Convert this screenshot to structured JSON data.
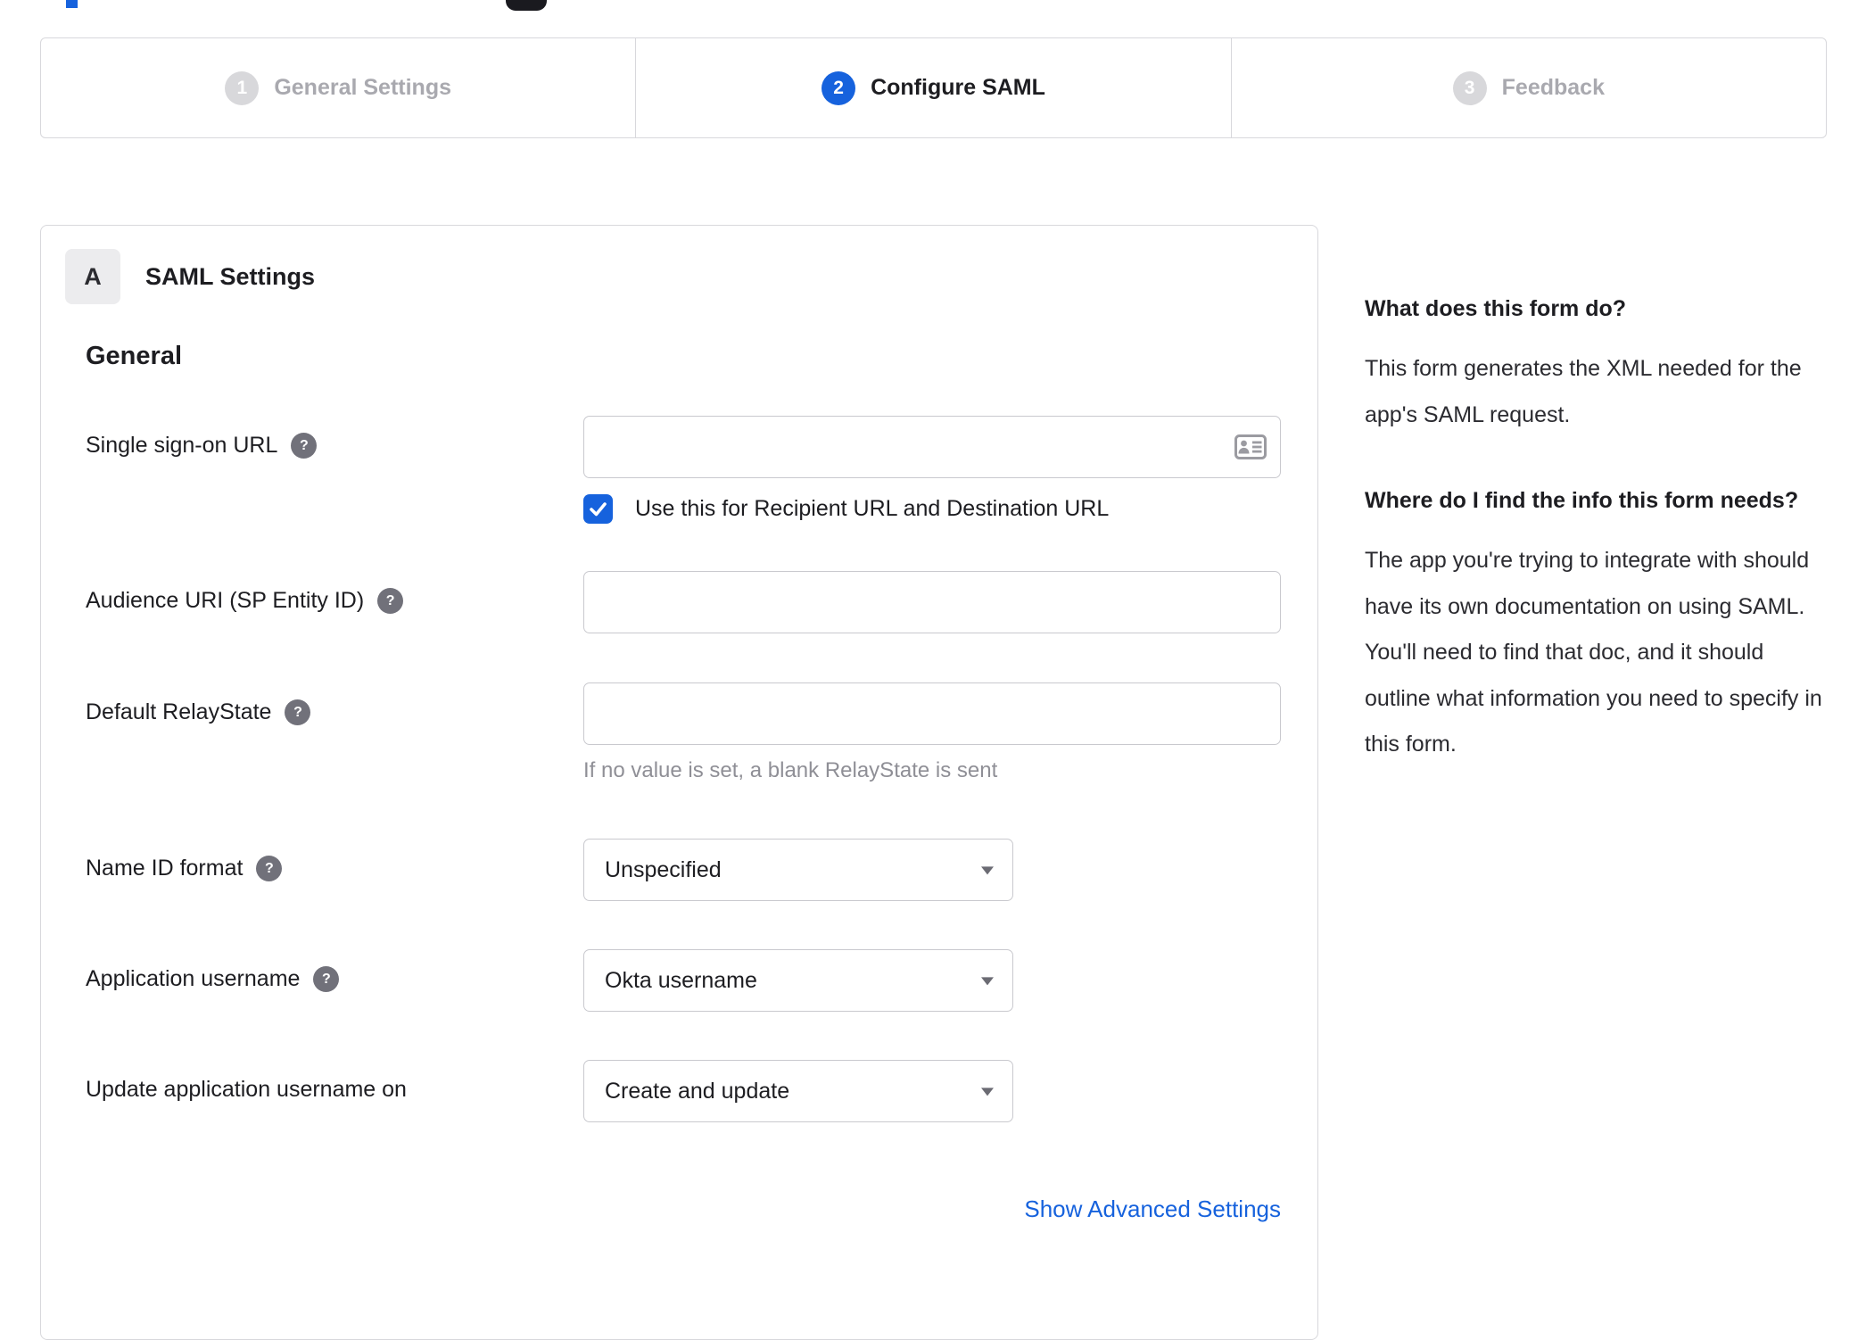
{
  "colors": {
    "accent_blue": "#1662dd",
    "inactive_step_gray": "#d8d8db",
    "border_gray": "#d8d8dc",
    "text_dark": "#1d1d21",
    "muted_gray": "#8f8f96",
    "help_icon_gray": "#71717a"
  },
  "stepper": {
    "steps": [
      {
        "number": "1",
        "label": "General Settings",
        "state": "inactive"
      },
      {
        "number": "2",
        "label": "Configure SAML",
        "state": "active"
      },
      {
        "number": "3",
        "label": "Feedback",
        "state": "inactive"
      }
    ]
  },
  "panel": {
    "badge": "A",
    "title": "SAML Settings",
    "section_title": "General",
    "help_glyph": "?",
    "fields": {
      "sso": {
        "label": "Single sign-on URL",
        "value": "",
        "placeholder": "",
        "checkbox_label": "Use this for Recipient URL and Destination URL",
        "checkbox_checked": true
      },
      "audience": {
        "label": "Audience URI (SP Entity ID)",
        "value": "",
        "placeholder": ""
      },
      "relay": {
        "label": "Default RelayState",
        "value": "",
        "placeholder": "",
        "hint": "If no value is set, a blank RelayState is sent"
      },
      "name_id": {
        "label": "Name ID format",
        "value": "Unspecified"
      },
      "app_username": {
        "label": "Application username",
        "value": "Okta username"
      },
      "update_username": {
        "label": "Update application username on",
        "value": "Create and update"
      }
    },
    "advanced_link": "Show Advanced Settings"
  },
  "sidebar": {
    "sections": [
      {
        "heading": "What does this form do?",
        "body": "This form generates the XML needed for the app's SAML request."
      },
      {
        "heading": "Where do I find the info this form needs?",
        "body": "The app you're trying to integrate with should have its own documentation on using SAML. You'll need to find that doc, and it should outline what information you need to specify in this form."
      }
    ]
  }
}
